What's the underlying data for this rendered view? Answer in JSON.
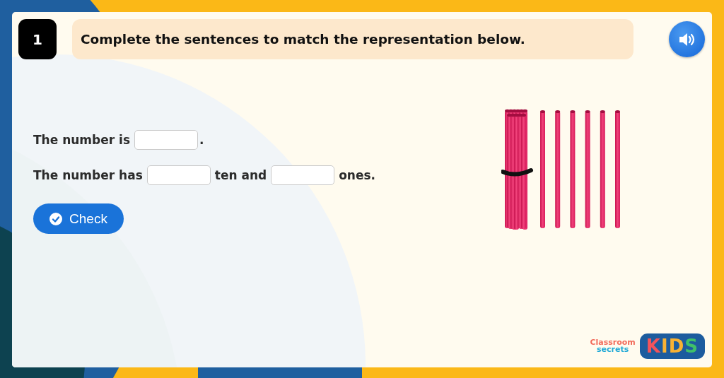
{
  "question": {
    "number": "1",
    "prompt": "Complete the sentences to match the representation below."
  },
  "sentences": [
    {
      "parts": [
        {
          "kind": "text",
          "text": "The number is"
        },
        {
          "kind": "blank"
        },
        {
          "kind": "text",
          "text": "."
        }
      ]
    },
    {
      "parts": [
        {
          "kind": "text",
          "text": "The number has"
        },
        {
          "kind": "blank"
        },
        {
          "kind": "text",
          "text": "ten and"
        },
        {
          "kind": "blank"
        },
        {
          "kind": "text",
          "text": "ones."
        }
      ]
    }
  ],
  "check_button": {
    "label": "Check"
  },
  "logo": {
    "line_1": "Classroom",
    "line_2": "secrets",
    "badge": "KIDS"
  }
}
